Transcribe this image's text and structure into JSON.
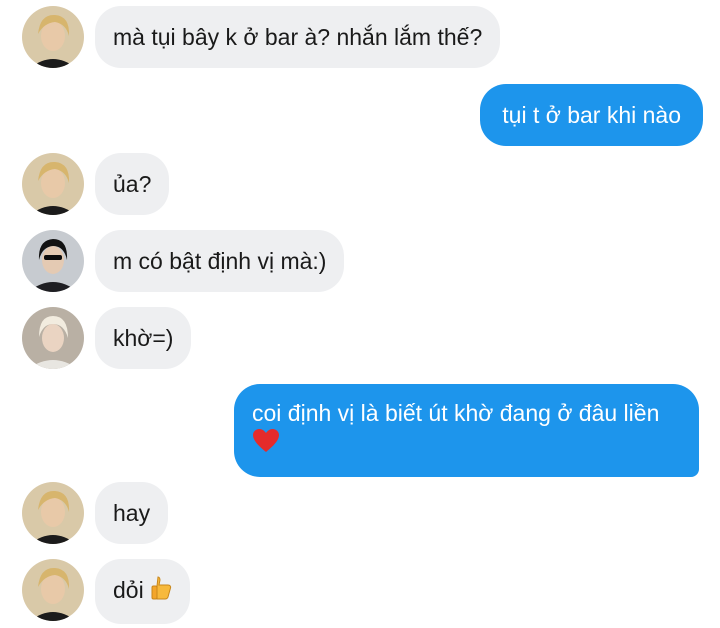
{
  "conversation": {
    "messages": [
      {
        "sender": "blonde-boy",
        "direction": "incoming",
        "text": "mà tụi bây k ở bar à? nhắn lắm thế?"
      },
      {
        "sender": "me",
        "direction": "outgoing",
        "text": "tụi t ở bar khi nào"
      },
      {
        "sender": "blonde-boy",
        "direction": "incoming",
        "text": "ủa?"
      },
      {
        "sender": "dark-hair-boy",
        "direction": "incoming",
        "text": "m có bật định vị mà:)"
      },
      {
        "sender": "platinum-boy",
        "direction": "incoming",
        "text": "khờ=)"
      },
      {
        "sender": "me",
        "direction": "outgoing",
        "text": "coi định vị là biết út khờ đang ở đâu liền",
        "emoji": "red-heart"
      },
      {
        "sender": "blonde-boy",
        "direction": "incoming",
        "text": "hay"
      },
      {
        "sender": "blonde-boy",
        "direction": "incoming",
        "text": "dỏi",
        "emoji": "thumbs-up"
      }
    ]
  },
  "colors": {
    "incoming_bubble": "#eeeff1",
    "outgoing_bubble": "#1d95ec",
    "incoming_text": "#1a1a1a",
    "outgoing_text": "#ffffff"
  }
}
